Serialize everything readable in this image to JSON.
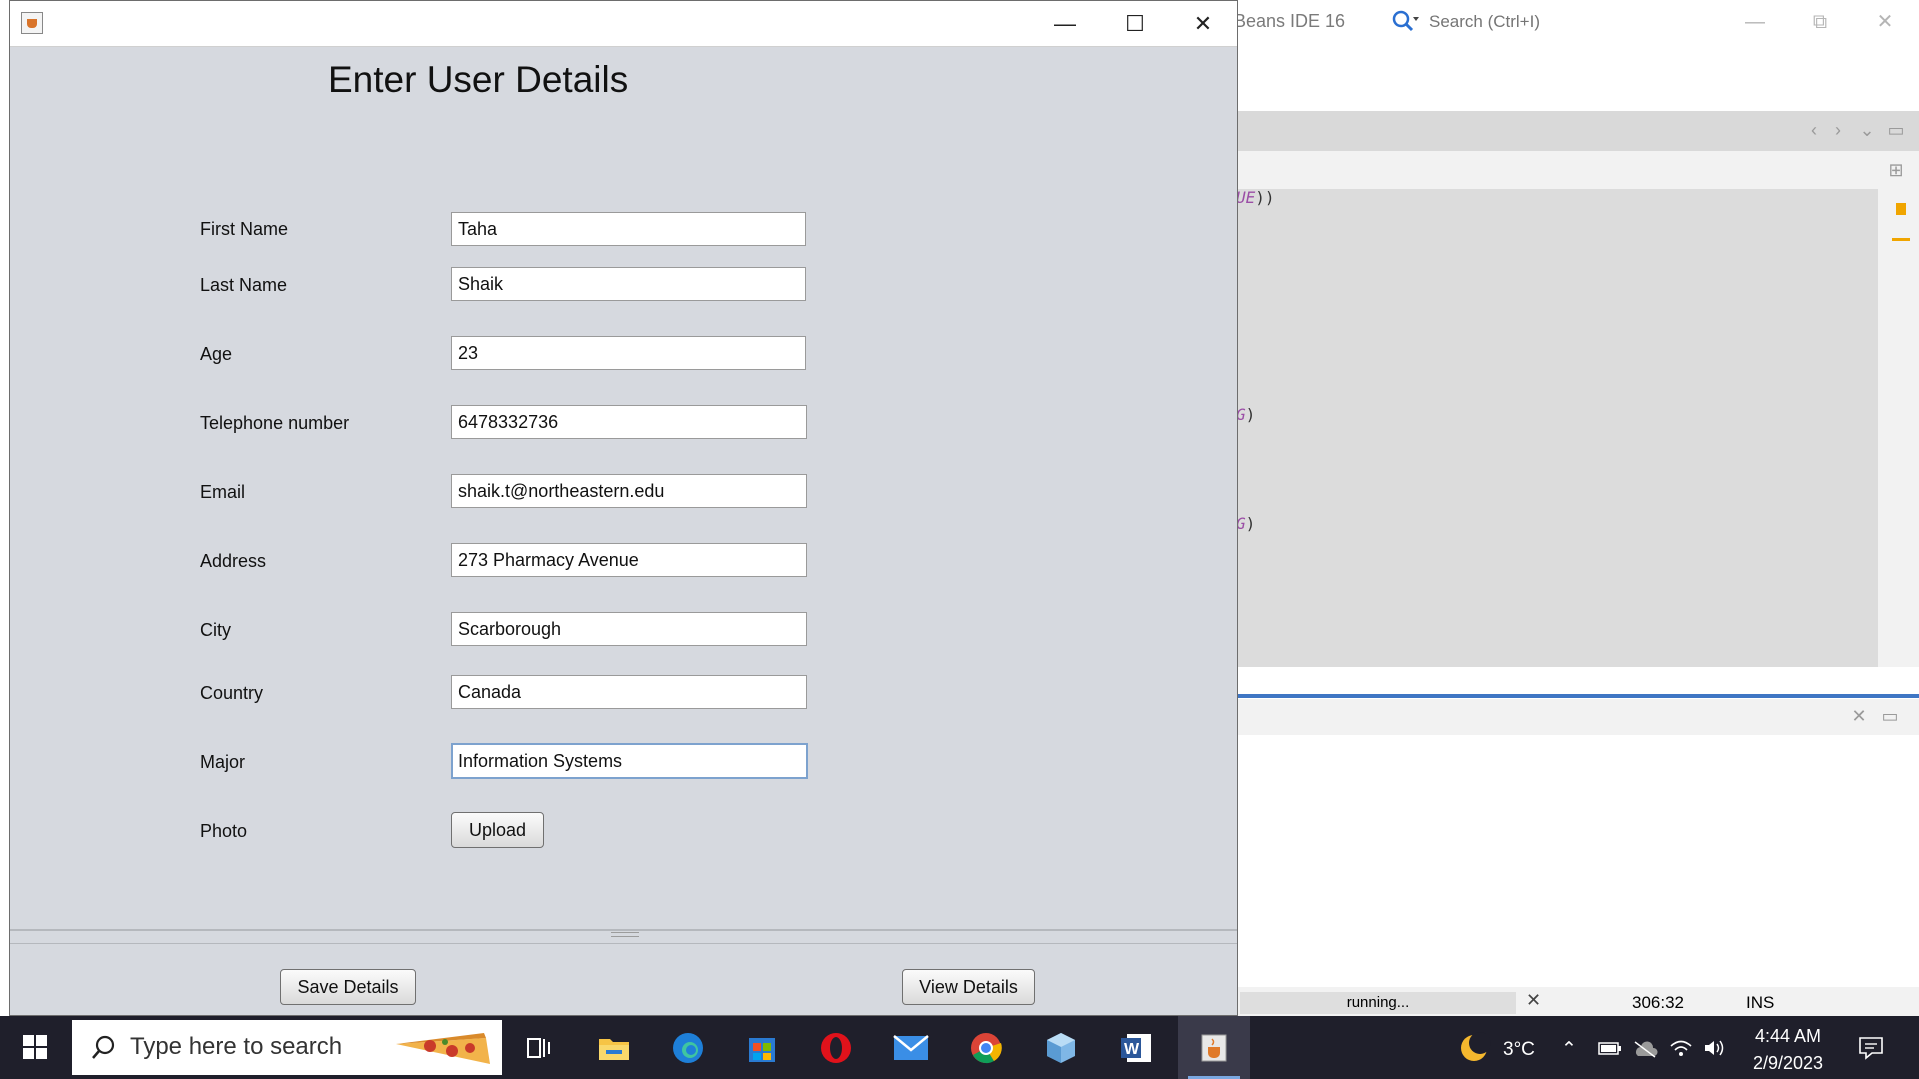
{
  "ide": {
    "title_fragment": "Beans IDE 16",
    "search_placeholder": "Search (Ctrl+I)",
    "code_fragments": [
      "UE))",
      "G)",
      "G)"
    ],
    "status": {
      "progress_label": "running...",
      "caret_position": "306:32",
      "insert_mode": "INS"
    }
  },
  "dialog": {
    "heading": "Enter User Details",
    "fields": [
      {
        "label": "First Name",
        "value": "Taha"
      },
      {
        "label": "Last Name",
        "value": "Shaik"
      },
      {
        "label": "Age",
        "value": "23"
      },
      {
        "label": "Telephone number",
        "value": "6478332736"
      },
      {
        "label": "Email",
        "value": "shaik.t@northeastern.edu"
      },
      {
        "label": "Address",
        "value": "273 Pharmacy Avenue"
      },
      {
        "label": "City",
        "value": "Scarborough"
      },
      {
        "label": "Country",
        "value": "Canada"
      },
      {
        "label": "Major",
        "value": "Information Systems"
      }
    ],
    "photo_label": "Photo",
    "upload_button": "Upload",
    "save_button": "Save Details",
    "view_button": "View Details"
  },
  "taskbar": {
    "search_placeholder": "Type here to search",
    "weather": "3°C",
    "time": "4:44 AM",
    "date": "2/9/2023",
    "apps": [
      "task-view-icon",
      "file-explorer-icon",
      "edge-icon",
      "microsoft-store-icon",
      "opera-icon",
      "mail-icon",
      "chrome-icon",
      "netbeans-icon",
      "word-icon",
      "java-icon"
    ]
  },
  "colors": {
    "dialog_background": "#d6d9df",
    "taskbar": "#1f1f2b",
    "focus_border": "#7da2ce",
    "ide_accent": "#3f76c4"
  }
}
